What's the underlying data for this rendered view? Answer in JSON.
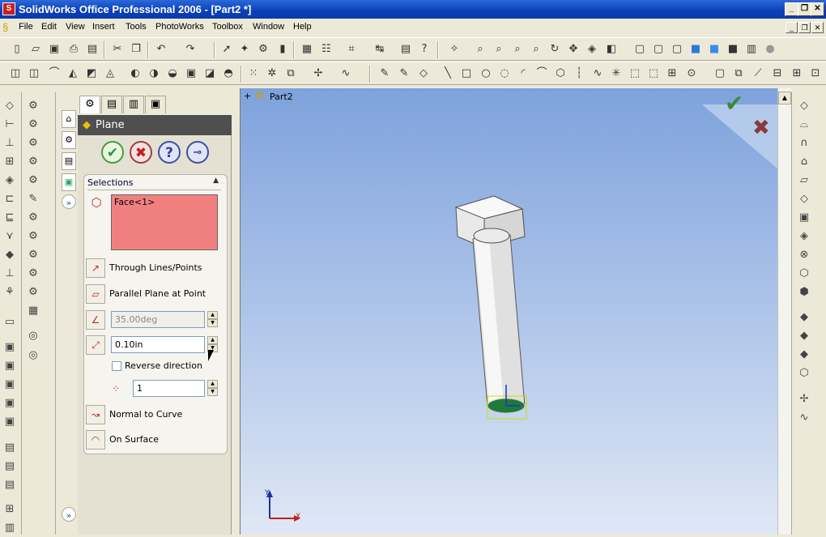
{
  "window": {
    "title": "SolidWorks Office Professional 2006 - [Part2 *]"
  },
  "menu": [
    "File",
    "Edit",
    "View",
    "Insert",
    "Tools",
    "PhotoWorks",
    "Toolbox",
    "Window",
    "Help"
  ],
  "feature_manager": {
    "header_title": "Plane",
    "selections_label": "Selections",
    "selected_item": "Face<1>",
    "options": {
      "through": "Through Lines/Points",
      "parallel": "Parallel Plane at Point",
      "normal": "Normal to Curve",
      "surface": "On Surface"
    },
    "angle_value": "35.00deg",
    "distance_value": "0.10in",
    "reverse_label": "Reverse direction",
    "count_value": "1"
  },
  "viewport": {
    "tree_label": "Part2",
    "axis_x": "X",
    "axis_y": "Y"
  }
}
